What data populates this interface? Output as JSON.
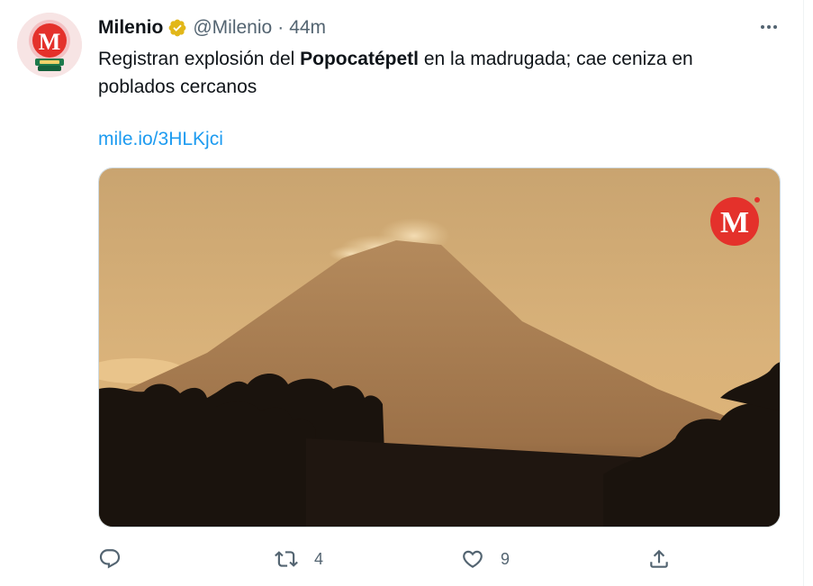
{
  "tweet": {
    "author_name": "Milenio",
    "handle": "@Milenio",
    "separator": "·",
    "time": "44m",
    "text_before": "Registran explosión del ",
    "text_bold": "Popocatépetl",
    "text_after": " en la madrugada; cae ceniza en poblados cercanos",
    "link": "mile.io/3HLKjci",
    "avatar_icon": "milenio-globe-logo-icon",
    "verified_icon": "gold-verified-badge-icon",
    "media": {
      "description_icon": "volcano-photo",
      "watermark_letter": "M"
    }
  },
  "actions": {
    "reply_count": "",
    "retweet_count": "4",
    "like_count": "9",
    "share_count": ""
  },
  "colors": {
    "link": "#1d9bf0",
    "secondary_text": "#536471",
    "verified_gold": "#e2b719",
    "brand_red": "#e4312b"
  }
}
